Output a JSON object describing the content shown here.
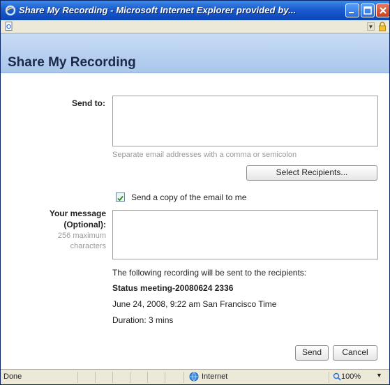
{
  "window": {
    "title": "Share My Recording - Microsoft Internet Explorer provided by..."
  },
  "header": {
    "title": "Share My Recording"
  },
  "form": {
    "send_to_label": "Send to:",
    "send_to_value": "",
    "send_to_hint": "Separate email addresses with a comma or semicolon",
    "select_recipients_label": "Select Recipients...",
    "copy_checkbox_label": "Send a copy of the email to me",
    "copy_checkbox_checked": true,
    "message_label_line1": "Your message",
    "message_label_line2": "(Optional):",
    "message_hint_line1": "256 maximum",
    "message_hint_line2": "characters",
    "message_value": ""
  },
  "recording": {
    "intro": "The following recording will be sent to the recipients:",
    "name": "Status meeting-20080624 2336",
    "datetime": "June 24, 2008, 9:22 am San Francisco Time",
    "duration": "Duration: 3 mins"
  },
  "actions": {
    "send_label": "Send",
    "cancel_label": "Cancel"
  },
  "statusbar": {
    "status": "Done",
    "zone": "Internet",
    "zoom": "100%"
  },
  "icons": {
    "ie": "ie-logo-icon",
    "page": "page-icon",
    "lock": "lock-icon",
    "globe": "globe-icon",
    "zoom": "zoom-icon"
  }
}
